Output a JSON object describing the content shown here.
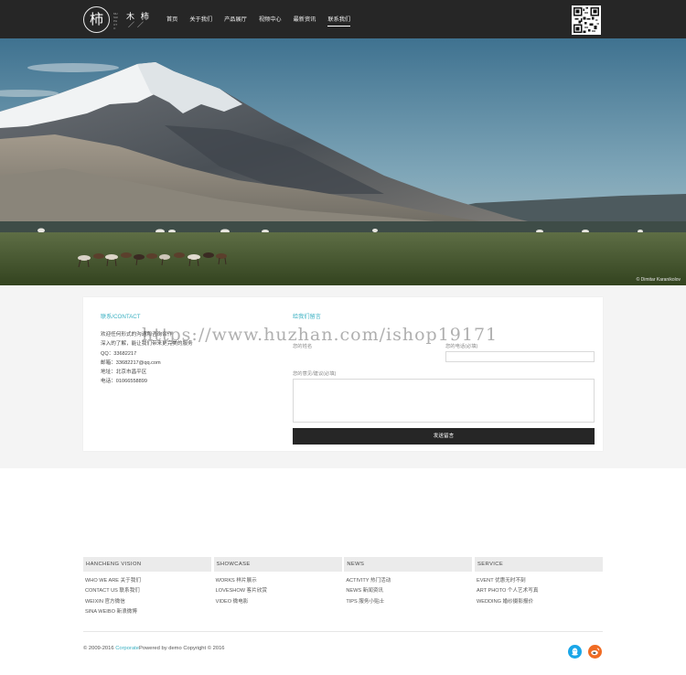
{
  "logo": {
    "glyph": "柿",
    "name": "木 柿",
    "small": "MUSHIPHOTO",
    "strokes": "／／"
  },
  "nav": [
    {
      "label": "首页",
      "active": false
    },
    {
      "label": "关于我们",
      "active": false
    },
    {
      "label": "产品展厅",
      "active": false
    },
    {
      "label": "视频中心",
      "active": false
    },
    {
      "label": "最新资讯",
      "active": false
    },
    {
      "label": "联系我们",
      "active": true
    }
  ],
  "hero": {
    "credit": "© Dimitar Karanikolov"
  },
  "contact": {
    "title": "联系/CONTACT",
    "lines": [
      "欢迎任何形式的沟通和咨询合作",
      "深入的了解，能让我们带来更完美的服务",
      "QQ：33682217",
      "邮箱：33682217@qq.com",
      "地址：北京市昌平区",
      "电话：01066558899"
    ]
  },
  "message_form": {
    "title": "给我们留言",
    "name_label": "您的姓名",
    "phone_label": "您的电话(必填)",
    "message_label": "您的意见/建议(必填)",
    "name_value": "",
    "phone_value": "",
    "message_value": "",
    "submit_label": "发送留言"
  },
  "watermark": "https://www.huzhan.com/ishop19171",
  "footer": {
    "columns": [
      {
        "title": "HANCHENG VISION",
        "links": [
          "WHO WE ARE 关于我们",
          "CONTACT US 联系我们",
          "WEIXIN 官方微信",
          "SINA WEIBO 新浪微博"
        ]
      },
      {
        "title": "SHOWCASE",
        "links": [
          "WORKS 样片展示",
          "LOVESHOW 客片欣赏",
          "VIDEO 微电影"
        ]
      },
      {
        "title": "NEWS",
        "links": [
          "ACTIVITY 热门活动",
          "NEWS 新闻资讯",
          "TIPS 服务小贴士"
        ]
      },
      {
        "title": "SERVICE",
        "links": [
          "EVENT 优惠无时不刻",
          "ART PHOTO 个人艺术写真",
          "WEDDING 婚纱摄影报价"
        ]
      }
    ],
    "copyright_pre": "© 2009-2016 ",
    "copyright_corp": "Corporate",
    "copyright_post": "Powered by demo Copyright © 2016"
  },
  "colors": {
    "accent": "#3ab0c2",
    "topbar": "#262626",
    "band": "#f4f4f4",
    "qq": "#1aa6e8",
    "weibo": "#f06b23"
  },
  "icons": {
    "qq": "qq-icon",
    "weibo": "weibo-icon",
    "qr": "qr-code"
  }
}
